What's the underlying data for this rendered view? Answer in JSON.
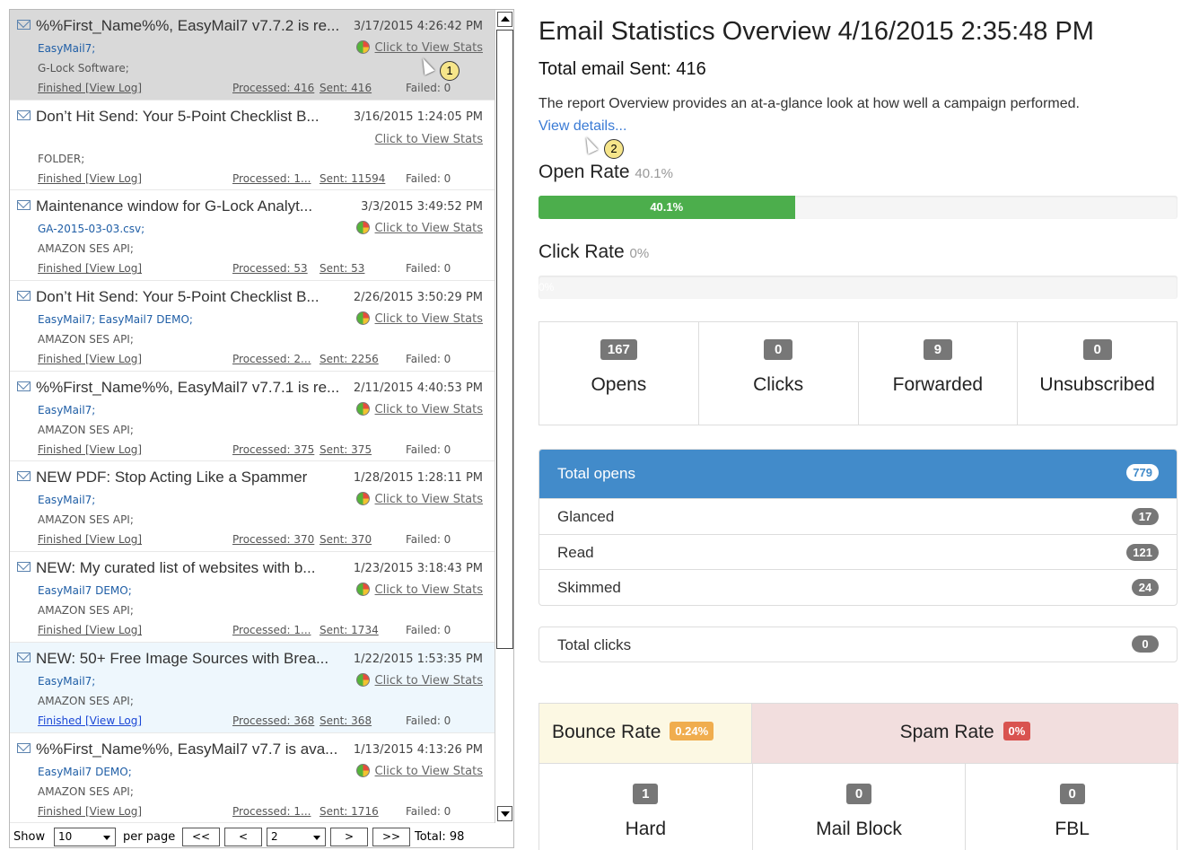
{
  "campaigns": [
    {
      "subject": "%%First_Name%%, EasyMail7 v7.7.2 is re...",
      "date": "3/17/2015 4:26:42 PM",
      "lists": "EasyMail7;",
      "sender": "G-Lock Software;",
      "stats": "Click to View Stats",
      "status": "Finished [View Log]",
      "processed": "Processed: 416",
      "sent": "Sent: 416",
      "failed": "Failed: 0"
    },
    {
      "subject": "Don’t Hit Send: Your 5-Point Checklist B...",
      "date": "3/16/2015 1:24:05 PM",
      "lists": "",
      "sender": "FOLDER;",
      "stats": "Click to View Stats",
      "status": "Finished [View Log]",
      "processed": "Processed: 1...",
      "sent": "Sent: 11594",
      "failed": "Failed: 0"
    },
    {
      "subject": "Maintenance window for G-Lock Analyt...",
      "date": "3/3/2015 3:49:52 PM",
      "lists": "GA-2015-03-03.csv;",
      "sender": "AMAZON SES API;",
      "stats": "Click to View Stats",
      "status": "Finished [View Log]",
      "processed": "Processed: 53",
      "sent": "Sent: 53",
      "failed": "Failed: 0"
    },
    {
      "subject": "Don’t Hit Send: Your 5-Point Checklist B...",
      "date": "2/26/2015 3:50:29 PM",
      "lists": "EasyMail7; EasyMail7 DEMO;",
      "sender": "AMAZON SES API;",
      "stats": "Click to View Stats",
      "status": "Finished [View Log]",
      "processed": "Processed: 2...",
      "sent": "Sent: 2256",
      "failed": "Failed: 0"
    },
    {
      "subject": "%%First_Name%%, EasyMail7 v7.7.1 is re...",
      "date": "2/11/2015 4:40:53 PM",
      "lists": "EasyMail7;",
      "sender": "AMAZON SES API;",
      "stats": "Click to View Stats",
      "status": "Finished [View Log]",
      "processed": "Processed: 375",
      "sent": "Sent: 375",
      "failed": "Failed: 0"
    },
    {
      "subject": "NEW PDF: Stop Acting Like a Spammer",
      "date": "1/28/2015 1:28:11 PM",
      "lists": "EasyMail7;",
      "sender": "AMAZON SES API;",
      "stats": "Click to View Stats",
      "status": "Finished [View Log]",
      "processed": "Processed: 370",
      "sent": "Sent: 370",
      "failed": "Failed: 0"
    },
    {
      "subject": "NEW: My curated list of websites with b...",
      "date": "1/23/2015 3:18:43 PM",
      "lists": "EasyMail7 DEMO;",
      "sender": "AMAZON SES API;",
      "stats": "Click to View Stats",
      "status": "Finished [View Log]",
      "processed": "Processed: 1...",
      "sent": "Sent: 1734",
      "failed": "Failed: 0"
    },
    {
      "subject": "NEW: 50+ Free Image Sources with Brea...",
      "date": "1/22/2015 1:53:35 PM",
      "lists": "EasyMail7;",
      "sender": "AMAZON SES API;",
      "stats": "Click to View Stats",
      "status": "Finished [View Log]",
      "processed": "Processed: 368",
      "sent": "Sent: 368",
      "failed": "Failed: 0"
    },
    {
      "subject": "%%First_Name%%, EasyMail7 v7.7 is ava...",
      "date": "1/13/2015 4:13:26 PM",
      "lists": "EasyMail7 DEMO;",
      "sender": "AMAZON SES API;",
      "stats": "Click to View Stats",
      "status": "Finished [View Log]",
      "processed": "Processed: 1...",
      "sent": "Sent: 1716",
      "failed": "Failed: 0"
    }
  ],
  "pager": {
    "show_label": "Show",
    "per_page_value": "10",
    "per_page_label": "per page",
    "first": "<<",
    "prev": "<",
    "page_value": "2",
    "next": ">",
    "last": ">>",
    "total": "Total: 98"
  },
  "callouts": {
    "one": "1",
    "two": "2"
  },
  "overview": {
    "title": "Email Statistics Overview 4/16/2015 2:35:48 PM",
    "total_sent": "Total email Sent: 416",
    "description": "The report Overview provides an at-a-glance look at how well a campaign performed.",
    "view_details": "View details..."
  },
  "open_rate": {
    "label": "Open Rate",
    "pct": "40.1%",
    "bar_text": "40.1%",
    "value": 0.401
  },
  "click_rate": {
    "label": "Click Rate",
    "pct": "0%",
    "bar_text": "0%",
    "value": 0
  },
  "counts": [
    {
      "num": "167",
      "label": "Opens"
    },
    {
      "num": "0",
      "label": "Clicks"
    },
    {
      "num": "9",
      "label": "Forwarded"
    },
    {
      "num": "0",
      "label": "Unsubscribed"
    }
  ],
  "opens_panel": {
    "header": "Total opens",
    "header_count": "779",
    "items": [
      {
        "label": "Glanced",
        "count": "17"
      },
      {
        "label": "Read",
        "count": "121"
      },
      {
        "label": "Skimmed",
        "count": "24"
      }
    ]
  },
  "clicks_panel": {
    "label": "Total clicks",
    "count": "0"
  },
  "bounce": {
    "bounce_label": "Bounce Rate",
    "bounce_pct": "0.24%",
    "spam_label": "Spam Rate",
    "spam_pct": "0%",
    "cells": [
      {
        "num": "1",
        "label": "Hard"
      },
      {
        "num": "0",
        "label": "Mail Block"
      },
      {
        "num": "0",
        "label": "FBL"
      }
    ]
  },
  "colors": {
    "accent": "#428bca",
    "success": "#4cae4c",
    "warning": "#f0ad4e",
    "danger": "#d9534f",
    "selected_row": "#d9d9d9"
  }
}
